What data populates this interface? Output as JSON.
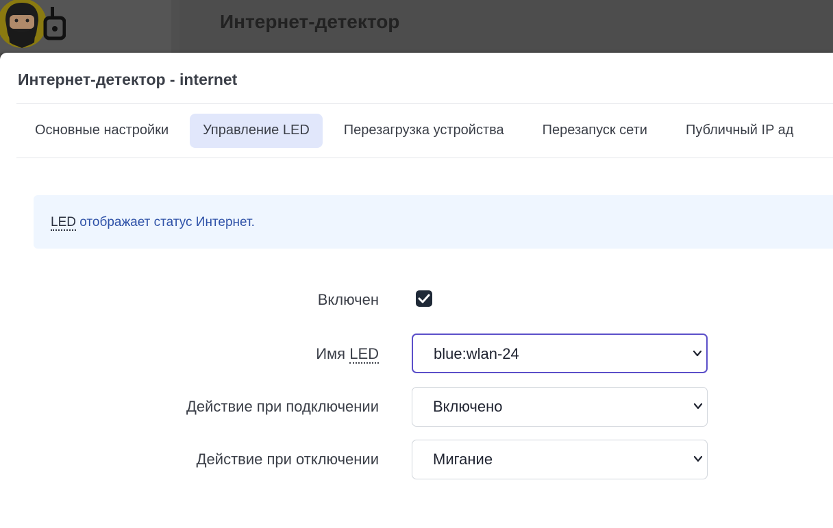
{
  "background": {
    "page_title": "Интернет-детектор"
  },
  "modal": {
    "title": "Интернет-детектор - internet",
    "tabs": [
      {
        "label": "Основные настройки",
        "active": false
      },
      {
        "label": "Управление LED",
        "active": true
      },
      {
        "label": "Перезагрузка устройства",
        "active": false
      },
      {
        "label": "Перезапуск сети",
        "active": false
      },
      {
        "label": "Публичный IP ад",
        "active": false
      }
    ],
    "info": {
      "abbr": "LED",
      "text": " отображает статус Интернет."
    },
    "form": {
      "enabled": {
        "label": "Включен",
        "checked": true
      },
      "led_name": {
        "label_prefix": "Имя ",
        "label_abbr": "LED",
        "value": "blue:wlan-24"
      },
      "on_connect": {
        "label": "Действие при подключении",
        "value": "Включено"
      },
      "on_disconnect": {
        "label": "Действие при отключении",
        "value": "Мигание"
      }
    }
  },
  "colors": {
    "accent_focus": "#5b4fc9",
    "active_tab_bg": "#e1e7fb",
    "info_bg": "#eff6ff",
    "info_text": "#2f52a8"
  }
}
